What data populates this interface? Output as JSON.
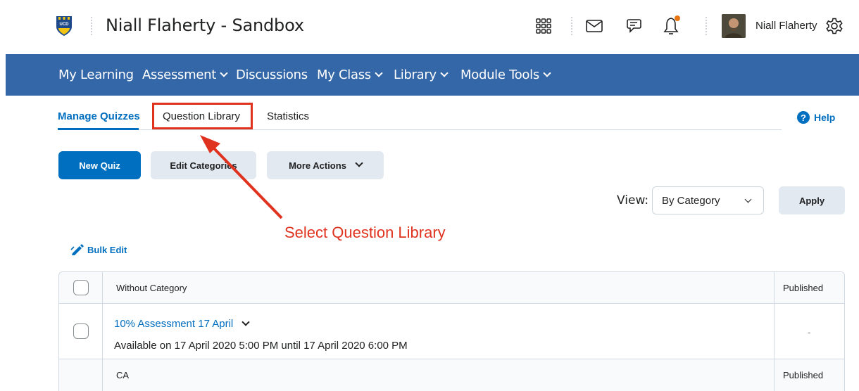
{
  "header": {
    "org_title": "Niall Flaherty - Sandbox",
    "user_name": "Niall Flaherty",
    "notification_dot_color": "#e87511"
  },
  "nav": {
    "items": [
      {
        "label": "My Learning",
        "has_dropdown": false
      },
      {
        "label": "Assessment",
        "has_dropdown": true
      },
      {
        "label": "Discussions",
        "has_dropdown": false
      },
      {
        "label": "My Class",
        "has_dropdown": true
      },
      {
        "label": "Library",
        "has_dropdown": true
      },
      {
        "label": "Module Tools",
        "has_dropdown": true
      }
    ],
    "background": "#3467a8"
  },
  "tabs": {
    "manage_quizzes": "Manage Quizzes",
    "question_library": "Question Library",
    "statistics": "Statistics",
    "help": "Help"
  },
  "toolbar": {
    "new_quiz": "New Quiz",
    "edit_categories": "Edit Categories",
    "more_actions": "More Actions"
  },
  "view": {
    "label": "View:",
    "selected": "By Category",
    "apply": "Apply"
  },
  "annotation": {
    "text": "Select Question Library",
    "color": "#e0331f"
  },
  "bulk_edit": "Bulk Edit",
  "table": {
    "category_header": "Without Category",
    "published_header": "Published",
    "quiz": {
      "name": "10% Assessment 17 April",
      "availability": "Available on 17 April 2020 5:00 PM until 17 April 2020 6:00 PM",
      "published": "-"
    },
    "category_2": "CA",
    "category_2_published": "Published"
  },
  "colors": {
    "accent": "#006fbf",
    "secondary_button": "#e3e9f1"
  }
}
